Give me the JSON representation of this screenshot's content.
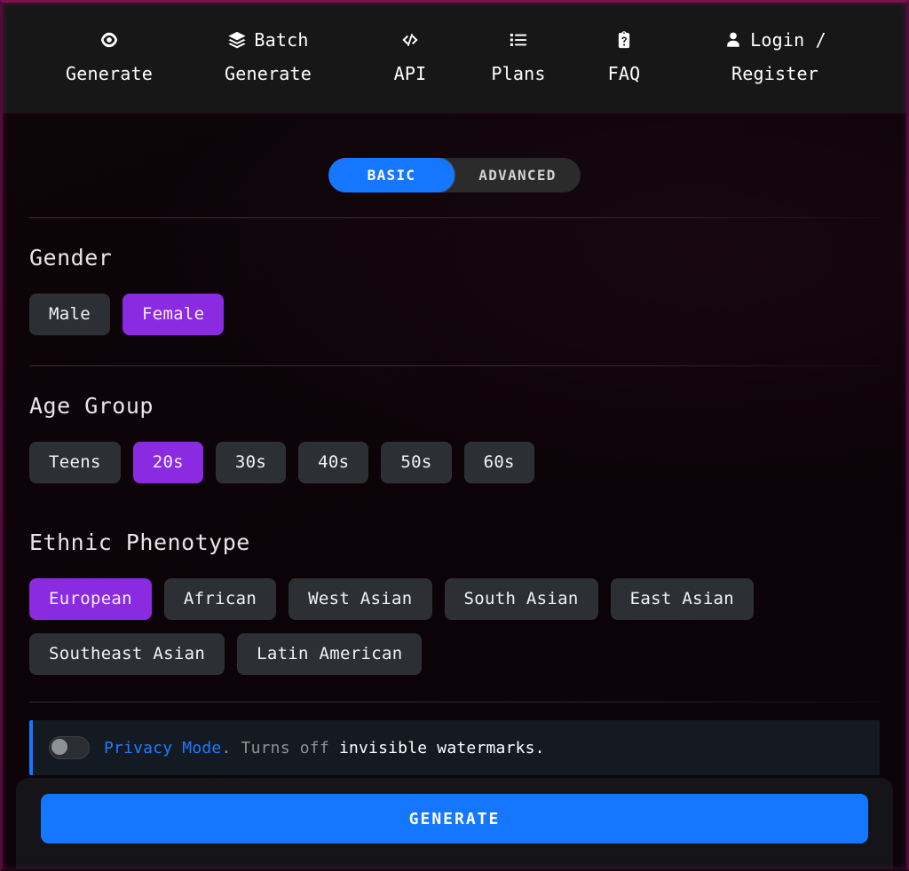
{
  "header": {
    "nav": [
      {
        "id": "generate",
        "icon": "eye-icon",
        "label_top": "",
        "label": "Generate"
      },
      {
        "id": "batch-generate",
        "icon": "layers-icon",
        "label_top": "Batch",
        "label": "Generate"
      },
      {
        "id": "api",
        "icon": "code-icon",
        "label_top": "",
        "label": "API"
      },
      {
        "id": "plans",
        "icon": "list-icon",
        "label_top": "",
        "label": "Plans"
      },
      {
        "id": "faq",
        "icon": "clipboard-question-icon",
        "label_top": "",
        "label": "FAQ"
      },
      {
        "id": "login-register",
        "icon": "user-icon",
        "label_top": "Login /",
        "label": "Register"
      }
    ]
  },
  "tabs": {
    "basic": "BASIC",
    "advanced": "ADVANCED",
    "active": "BASIC"
  },
  "sections": {
    "gender": {
      "title": "Gender",
      "options": [
        "Male",
        "Female"
      ],
      "selected": "Female"
    },
    "age": {
      "title": "Age Group",
      "options": [
        "Teens",
        "20s",
        "30s",
        "40s",
        "50s",
        "60s"
      ],
      "selected": "20s"
    },
    "ethnic": {
      "title": "Ethnic Phenotype",
      "row1": [
        "European",
        "African",
        "West Asian",
        "South Asian",
        "East Asian"
      ],
      "row2": [
        "Southeast Asian",
        "Latin American"
      ],
      "selected": "European"
    }
  },
  "privacy": {
    "toggle_state": "off",
    "label": "Privacy Mode",
    "punct": ".",
    "description_muted": "Turns off",
    "description_strong": "invisible watermarks."
  },
  "footer": {
    "generate_label": "GENERATE"
  },
  "colors": {
    "accent_blue": "#1577ff",
    "accent_purple": "#8a2be2",
    "chip_bg": "#2c3034",
    "header_bg": "#171717",
    "page_bg": "#0c0509",
    "frame_glow": "#7d1150"
  }
}
